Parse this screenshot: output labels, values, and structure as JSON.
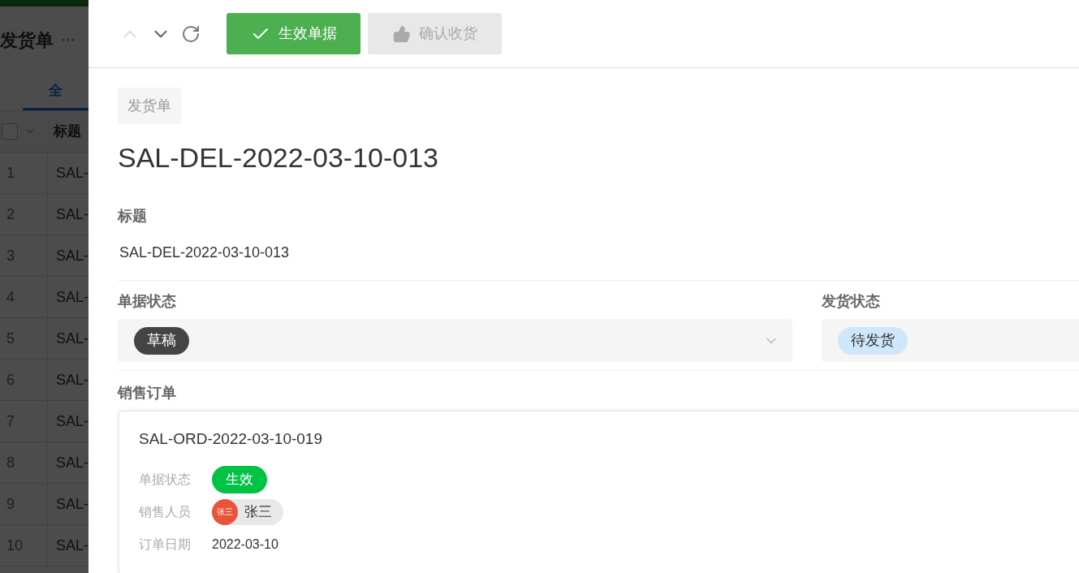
{
  "background_page": {
    "title": "发货单",
    "tabs": [
      {
        "label": "全",
        "selected": true
      }
    ],
    "select_all": {
      "checked": false
    },
    "column_header": "标题",
    "rows": [
      {
        "index": "1",
        "title": "SAL-"
      },
      {
        "index": "2",
        "title": "SAL-"
      },
      {
        "index": "3",
        "title": "SAL-"
      },
      {
        "index": "4",
        "title": "SAL-"
      },
      {
        "index": "5",
        "title": "SAL-"
      },
      {
        "index": "6",
        "title": "SAL-"
      },
      {
        "index": "7",
        "title": "SAL-"
      },
      {
        "index": "8",
        "title": "SAL-"
      },
      {
        "index": "9",
        "title": "SAL-"
      },
      {
        "index": "10",
        "title": "SAL-"
      }
    ]
  },
  "toolbar": {
    "previous": {
      "disabled": true
    },
    "next": {
      "disabled": false
    },
    "buttons": [
      {
        "label": "生效单据",
        "kind": "primary",
        "disabled": false
      },
      {
        "label": "确认收货",
        "kind": "like",
        "disabled": true
      }
    ]
  },
  "doc_type": "发货单",
  "title": "SAL-DEL-2022-03-10-013",
  "title_field": {
    "label": "标题",
    "value": "SAL-DEL-2022-03-10-013"
  },
  "status_fields": [
    {
      "label": "单据状态",
      "tag": "草稿",
      "color": "#444444",
      "has_chevron": true
    },
    {
      "label": "发货状态",
      "tag": "待发货",
      "color": "#cfe6fb",
      "has_chevron": false
    }
  ],
  "sales_order": {
    "label": "销售订单",
    "number": "SAL-ORD-2022-03-10-019",
    "rows": [
      {
        "label": "单据状态",
        "kind": "tag",
        "value": "生效",
        "color": "#00c244"
      },
      {
        "label": "销售人员",
        "kind": "person",
        "value": "张三",
        "avatar_text": "张三"
      },
      {
        "label": "订单日期",
        "kind": "text",
        "value": "2022-03-10"
      }
    ]
  }
}
